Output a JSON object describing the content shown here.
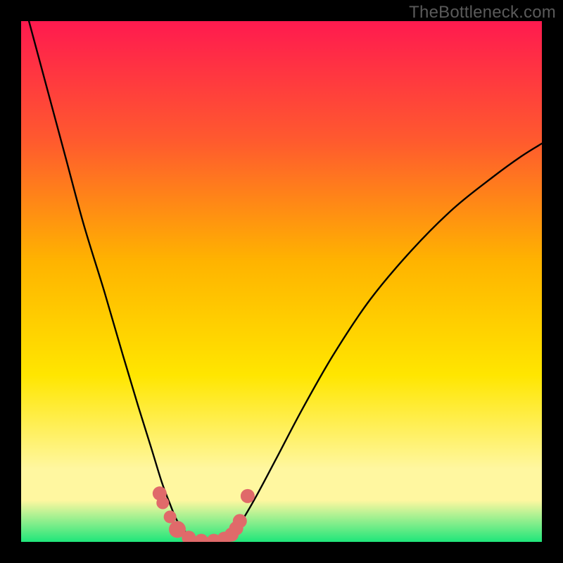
{
  "watermark": "TheBottleneck.com",
  "colors": {
    "frame": "#000000",
    "gradient_top": "#ff1a4f",
    "gradient_mid1": "#ff5a2e",
    "gradient_mid2": "#ffb300",
    "gradient_mid3": "#ffe600",
    "gradient_mid4": "#fff7a0",
    "gradient_bottom": "#1fe67a",
    "curve": "#000000",
    "markers": "#e06a6a"
  },
  "chart_data": {
    "type": "line",
    "title": "",
    "xlabel": "",
    "ylabel": "",
    "xlim": [
      0,
      1
    ],
    "ylim": [
      0,
      1
    ],
    "note": "Axes are normalized 0–1; no numeric tick labels are visible in the image. Curve traced from pixels.",
    "series": [
      {
        "name": "bottleneck-curve",
        "x": [
          0.015,
          0.05,
          0.085,
          0.12,
          0.16,
          0.195,
          0.225,
          0.25,
          0.27,
          0.285,
          0.3,
          0.32,
          0.345,
          0.37,
          0.395,
          0.42,
          0.45,
          0.49,
          0.54,
          0.6,
          0.67,
          0.75,
          0.83,
          0.905,
          0.96,
          1.0
        ],
        "y": [
          1.0,
          0.87,
          0.74,
          0.61,
          0.48,
          0.36,
          0.26,
          0.18,
          0.115,
          0.075,
          0.04,
          0.015,
          0.0,
          0.0,
          0.01,
          0.035,
          0.085,
          0.16,
          0.255,
          0.36,
          0.465,
          0.56,
          0.64,
          0.7,
          0.74,
          0.765
        ]
      }
    ],
    "markers": [
      {
        "x": 0.266,
        "y": 0.093,
        "r": 10
      },
      {
        "x": 0.272,
        "y": 0.075,
        "r": 9
      },
      {
        "x": 0.286,
        "y": 0.048,
        "r": 9
      },
      {
        "x": 0.3,
        "y": 0.024,
        "r": 12
      },
      {
        "x": 0.322,
        "y": 0.008,
        "r": 10
      },
      {
        "x": 0.346,
        "y": 0.002,
        "r": 10
      },
      {
        "x": 0.37,
        "y": 0.002,
        "r": 10
      },
      {
        "x": 0.39,
        "y": 0.006,
        "r": 10
      },
      {
        "x": 0.404,
        "y": 0.014,
        "r": 10
      },
      {
        "x": 0.413,
        "y": 0.026,
        "r": 10
      },
      {
        "x": 0.42,
        "y": 0.04,
        "r": 10
      },
      {
        "x": 0.435,
        "y": 0.088,
        "r": 10
      }
    ]
  }
}
